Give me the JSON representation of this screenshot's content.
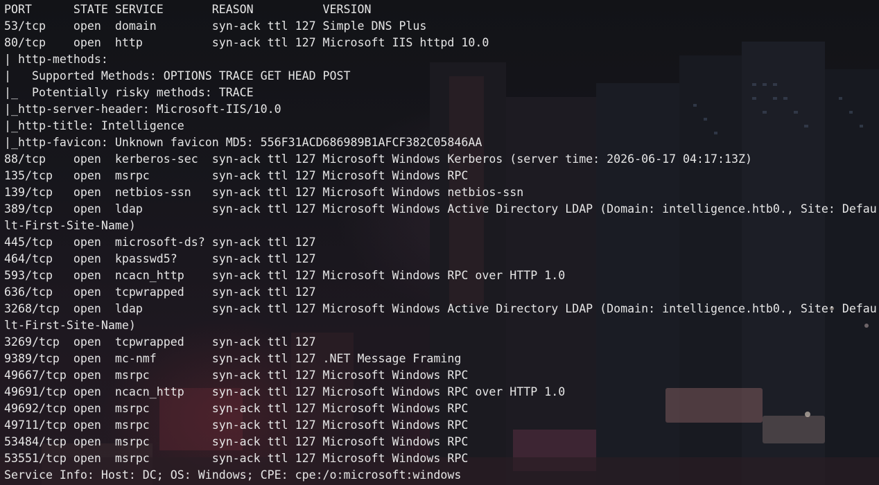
{
  "terminal": {
    "lines": [
      "PORT      STATE SERVICE       REASON          VERSION",
      "53/tcp    open  domain        syn-ack ttl 127 Simple DNS Plus",
      "80/tcp    open  http          syn-ack ttl 127 Microsoft IIS httpd 10.0",
      "| http-methods: ",
      "|   Supported Methods: OPTIONS TRACE GET HEAD POST",
      "|_  Potentially risky methods: TRACE",
      "|_http-server-header: Microsoft-IIS/10.0",
      "|_http-title: Intelligence",
      "|_http-favicon: Unknown favicon MD5: 556F31ACD686989B1AFCF382C05846AA",
      "88/tcp    open  kerberos-sec  syn-ack ttl 127 Microsoft Windows Kerberos (server time: 2026-06-17 04:17:13Z)",
      "135/tcp   open  msrpc         syn-ack ttl 127 Microsoft Windows RPC",
      "139/tcp   open  netbios-ssn   syn-ack ttl 127 Microsoft Windows netbios-ssn",
      "389/tcp   open  ldap          syn-ack ttl 127 Microsoft Windows Active Directory LDAP (Domain: intelligence.htb0., Site: Defau",
      "lt-First-Site-Name)",
      "445/tcp   open  microsoft-ds? syn-ack ttl 127",
      "464/tcp   open  kpasswd5?     syn-ack ttl 127",
      "593/tcp   open  ncacn_http    syn-ack ttl 127 Microsoft Windows RPC over HTTP 1.0",
      "636/tcp   open  tcpwrapped    syn-ack ttl 127",
      "3268/tcp  open  ldap          syn-ack ttl 127 Microsoft Windows Active Directory LDAP (Domain: intelligence.htb0., Site: Defau",
      "lt-First-Site-Name)",
      "3269/tcp  open  tcpwrapped    syn-ack ttl 127",
      "9389/tcp  open  mc-nmf        syn-ack ttl 127 .NET Message Framing",
      "49667/tcp open  msrpc         syn-ack ttl 127 Microsoft Windows RPC",
      "49691/tcp open  ncacn_http    syn-ack ttl 127 Microsoft Windows RPC over HTTP 1.0",
      "49692/tcp open  msrpc         syn-ack ttl 127 Microsoft Windows RPC",
      "49711/tcp open  msrpc         syn-ack ttl 127 Microsoft Windows RPC",
      "53484/tcp open  msrpc         syn-ack ttl 127 Microsoft Windows RPC",
      "53551/tcp open  msrpc         syn-ack ttl 127 Microsoft Windows RPC",
      "Service Info: Host: DC; OS: Windows; CPE: cpe:/o:microsoft:windows"
    ]
  },
  "theme": {
    "text_color": "#e6e6e6",
    "background_color": "#15151b"
  }
}
